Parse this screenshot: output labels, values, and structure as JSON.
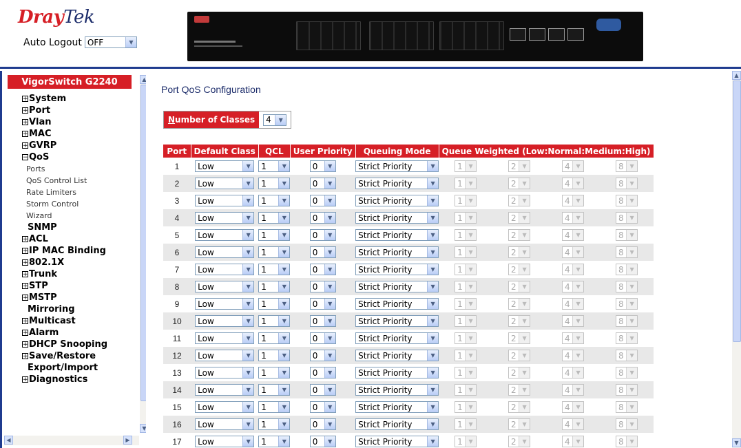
{
  "brand": {
    "dray": "Dray",
    "tek": "Tek"
  },
  "auto_logout": {
    "label": "Auto Logout",
    "value": "OFF"
  },
  "sidebar": {
    "title": "VigorSwitch G2240",
    "items": [
      {
        "label": "System",
        "icon": "plus"
      },
      {
        "label": "Port",
        "icon": "plus"
      },
      {
        "label": "Vlan",
        "icon": "plus"
      },
      {
        "label": "MAC",
        "icon": "plus"
      },
      {
        "label": "GVRP",
        "icon": "plus"
      },
      {
        "label": "QoS",
        "icon": "minus"
      },
      {
        "label": "Ports",
        "sub": true
      },
      {
        "label": "QoS Control List",
        "sub": true
      },
      {
        "label": "Rate Limiters",
        "sub": true
      },
      {
        "label": "Storm Control",
        "sub": true
      },
      {
        "label": "Wizard",
        "sub": true
      },
      {
        "label": "SNMP",
        "icon": "none"
      },
      {
        "label": "ACL",
        "icon": "plus"
      },
      {
        "label": "IP MAC Binding",
        "icon": "plus"
      },
      {
        "label": "802.1X",
        "icon": "plus"
      },
      {
        "label": "Trunk",
        "icon": "plus"
      },
      {
        "label": "STP",
        "icon": "plus"
      },
      {
        "label": "MSTP",
        "icon": "plus"
      },
      {
        "label": "Mirroring",
        "icon": "none"
      },
      {
        "label": "Multicast",
        "icon": "plus"
      },
      {
        "label": "Alarm",
        "icon": "plus"
      },
      {
        "label": "DHCP Snooping",
        "icon": "plus"
      },
      {
        "label": "Save/Restore",
        "icon": "plus"
      },
      {
        "label": "Export/Import",
        "icon": "none"
      },
      {
        "label": "Diagnostics",
        "icon": "plus"
      }
    ]
  },
  "main": {
    "title": "Port QoS Configuration",
    "classes_label_first": "N",
    "classes_label_rest": "umber of Classes",
    "classes_value": "4",
    "headers": [
      "Port",
      "Default Class",
      "QCL",
      "User Priority",
      "Queuing Mode",
      "Queue Weighted (Low:Normal:Medium:High)"
    ],
    "rows": [
      {
        "port": "1",
        "cls": "Low",
        "qcl": "1",
        "pri": "0",
        "mode": "Strict Priority",
        "w": [
          "1",
          "2",
          "4",
          "8"
        ]
      },
      {
        "port": "2",
        "cls": "Low",
        "qcl": "1",
        "pri": "0",
        "mode": "Strict Priority",
        "w": [
          "1",
          "2",
          "4",
          "8"
        ]
      },
      {
        "port": "3",
        "cls": "Low",
        "qcl": "1",
        "pri": "0",
        "mode": "Strict Priority",
        "w": [
          "1",
          "2",
          "4",
          "8"
        ]
      },
      {
        "port": "4",
        "cls": "Low",
        "qcl": "1",
        "pri": "0",
        "mode": "Strict Priority",
        "w": [
          "1",
          "2",
          "4",
          "8"
        ]
      },
      {
        "port": "5",
        "cls": "Low",
        "qcl": "1",
        "pri": "0",
        "mode": "Strict Priority",
        "w": [
          "1",
          "2",
          "4",
          "8"
        ]
      },
      {
        "port": "6",
        "cls": "Low",
        "qcl": "1",
        "pri": "0",
        "mode": "Strict Priority",
        "w": [
          "1",
          "2",
          "4",
          "8"
        ]
      },
      {
        "port": "7",
        "cls": "Low",
        "qcl": "1",
        "pri": "0",
        "mode": "Strict Priority",
        "w": [
          "1",
          "2",
          "4",
          "8"
        ]
      },
      {
        "port": "8",
        "cls": "Low",
        "qcl": "1",
        "pri": "0",
        "mode": "Strict Priority",
        "w": [
          "1",
          "2",
          "4",
          "8"
        ]
      },
      {
        "port": "9",
        "cls": "Low",
        "qcl": "1",
        "pri": "0",
        "mode": "Strict Priority",
        "w": [
          "1",
          "2",
          "4",
          "8"
        ]
      },
      {
        "port": "10",
        "cls": "Low",
        "qcl": "1",
        "pri": "0",
        "mode": "Strict Priority",
        "w": [
          "1",
          "2",
          "4",
          "8"
        ]
      },
      {
        "port": "11",
        "cls": "Low",
        "qcl": "1",
        "pri": "0",
        "mode": "Strict Priority",
        "w": [
          "1",
          "2",
          "4",
          "8"
        ]
      },
      {
        "port": "12",
        "cls": "Low",
        "qcl": "1",
        "pri": "0",
        "mode": "Strict Priority",
        "w": [
          "1",
          "2",
          "4",
          "8"
        ]
      },
      {
        "port": "13",
        "cls": "Low",
        "qcl": "1",
        "pri": "0",
        "mode": "Strict Priority",
        "w": [
          "1",
          "2",
          "4",
          "8"
        ]
      },
      {
        "port": "14",
        "cls": "Low",
        "qcl": "1",
        "pri": "0",
        "mode": "Strict Priority",
        "w": [
          "1",
          "2",
          "4",
          "8"
        ]
      },
      {
        "port": "15",
        "cls": "Low",
        "qcl": "1",
        "pri": "0",
        "mode": "Strict Priority",
        "w": [
          "1",
          "2",
          "4",
          "8"
        ]
      },
      {
        "port": "16",
        "cls": "Low",
        "qcl": "1",
        "pri": "0",
        "mode": "Strict Priority",
        "w": [
          "1",
          "2",
          "4",
          "8"
        ]
      },
      {
        "port": "17",
        "cls": "Low",
        "qcl": "1",
        "pri": "0",
        "mode": "Strict Priority",
        "w": [
          "1",
          "2",
          "4",
          "8"
        ]
      }
    ]
  },
  "colors": {
    "accent": "#d61f26",
    "brand_dark": "#1d2d6b",
    "row_alt": "#e8e8e8"
  }
}
